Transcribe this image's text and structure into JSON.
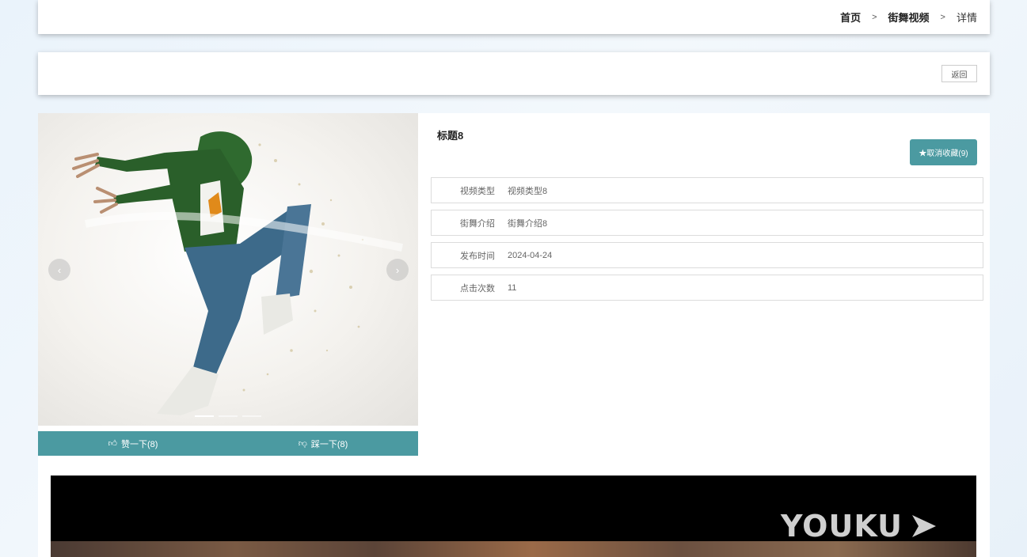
{
  "breadcrumb": {
    "home": "首页",
    "section": "街舞视频",
    "current": "详情",
    "separator": ">"
  },
  "actions": {
    "back_label": "返回"
  },
  "carousel": {
    "prev": "‹",
    "next": "›",
    "slide_count": 3,
    "active_index": 0
  },
  "votes": {
    "like_label": "赞一下(8)",
    "dislike_label": "踩一下(8)",
    "like_icon": "thumbs-up-icon",
    "dislike_icon": "thumbs-down-icon"
  },
  "detail": {
    "title": "标题8",
    "favorite_label": "★取消收藏(9)",
    "fields": [
      {
        "label": "视频类型",
        "value": "视频类型8"
      },
      {
        "label": "街舞介绍",
        "value": "街舞介绍8"
      },
      {
        "label": "发布时间",
        "value": "2024-04-24"
      },
      {
        "label": "点击次数",
        "value": "11"
      }
    ]
  },
  "video": {
    "logo_text": "YOUKU"
  },
  "colors": {
    "accent": "#4b9aa1"
  }
}
